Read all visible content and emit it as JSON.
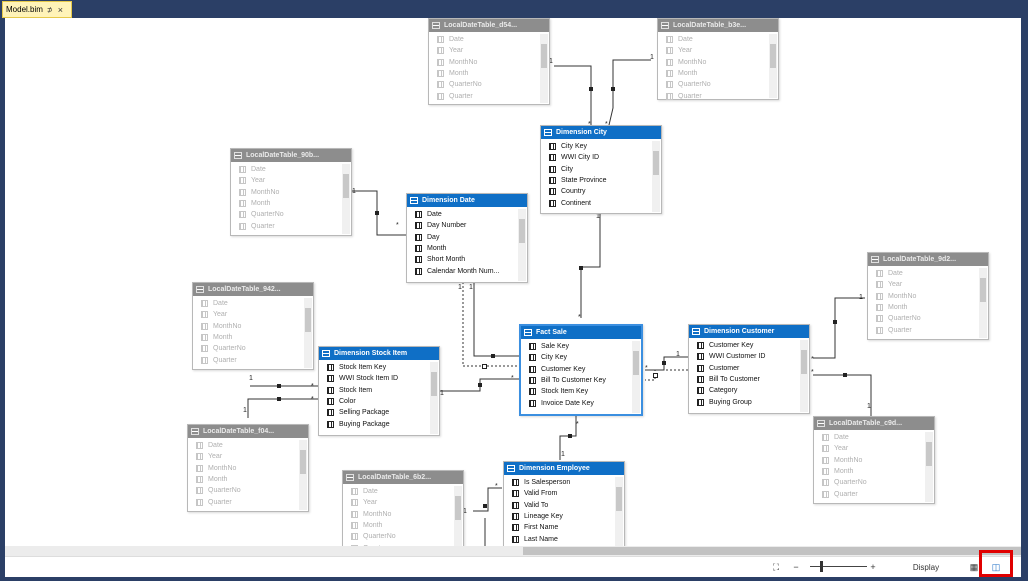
{
  "tab": {
    "title": "Model.bim",
    "pin": "⊅",
    "close": "×"
  },
  "tables": {
    "ld_d54": {
      "title": "LocalDateTable_d54...",
      "rows": [
        "Date",
        "Year",
        "MonthNo",
        "Month",
        "QuarterNo",
        "Quarter"
      ]
    },
    "ld_b3e": {
      "title": "LocalDateTable_b3e...",
      "rows": [
        "Date",
        "Year",
        "MonthNo",
        "Month",
        "QuarterNo",
        "Quarter"
      ]
    },
    "ld_90b": {
      "title": "LocalDateTable_90b...",
      "rows": [
        "Date",
        "Year",
        "MonthNo",
        "Month",
        "QuarterNo",
        "Quarter"
      ]
    },
    "dim_city": {
      "title": "Dimension City",
      "rows": [
        "City Key",
        "WWI City ID",
        "City",
        "State Province",
        "Country",
        "Continent"
      ]
    },
    "dim_date": {
      "title": "Dimension Date",
      "rows": [
        "Date",
        "Day Number",
        "Day",
        "Month",
        "Short Month",
        "Calendar Month Num..."
      ]
    },
    "ld_942": {
      "title": "LocalDateTable_942...",
      "rows": [
        "Date",
        "Year",
        "MonthNo",
        "Month",
        "QuarterNo",
        "Quarter"
      ]
    },
    "ld_9d2": {
      "title": "LocalDateTable_9d2...",
      "rows": [
        "Date",
        "Year",
        "MonthNo",
        "Month",
        "QuarterNo",
        "Quarter"
      ]
    },
    "dim_stock": {
      "title": "Dimension Stock Item",
      "rows": [
        "Stock Item Key",
        "WWI Stock Item ID",
        "Stock Item",
        "Color",
        "Selling Package",
        "Buying Package"
      ]
    },
    "fact_sale": {
      "title": "Fact Sale",
      "rows": [
        "Sale Key",
        "City Key",
        "Customer Key",
        "Bill To Customer Key",
        "Stock Item Key",
        "Invoice Date Key"
      ]
    },
    "dim_customer": {
      "title": "Dimension Customer",
      "rows": [
        "Customer Key",
        "WWI Customer ID",
        "Customer",
        "Bill To Customer",
        "Category",
        "Buying Group"
      ]
    },
    "ld_f04": {
      "title": "LocalDateTable_f04...",
      "rows": [
        "Date",
        "Year",
        "MonthNo",
        "Month",
        "QuarterNo",
        "Quarter"
      ]
    },
    "ld_c9d": {
      "title": "LocalDateTable_c9d...",
      "rows": [
        "Date",
        "Year",
        "MonthNo",
        "Month",
        "QuarterNo",
        "Quarter"
      ]
    },
    "ld_6b2": {
      "title": "LocalDateTable_6b2...",
      "rows": [
        "Date",
        "Year",
        "MonthNo",
        "Month",
        "QuarterNo",
        "Quarter"
      ]
    },
    "dim_employee": {
      "title": "Dimension Employee",
      "rows": [
        "Is Salesperson",
        "Valid From",
        "Valid To",
        "Lineage Key",
        "First Name",
        "Last Name"
      ]
    }
  },
  "cardinality": {
    "one": "1",
    "many": "*"
  },
  "statusbar": {
    "fit_icon": "⛶",
    "zoom_out": "−",
    "zoom_in": "+",
    "display_label": "Display",
    "grid_icon": "▦",
    "diagram_icon": "◫"
  }
}
